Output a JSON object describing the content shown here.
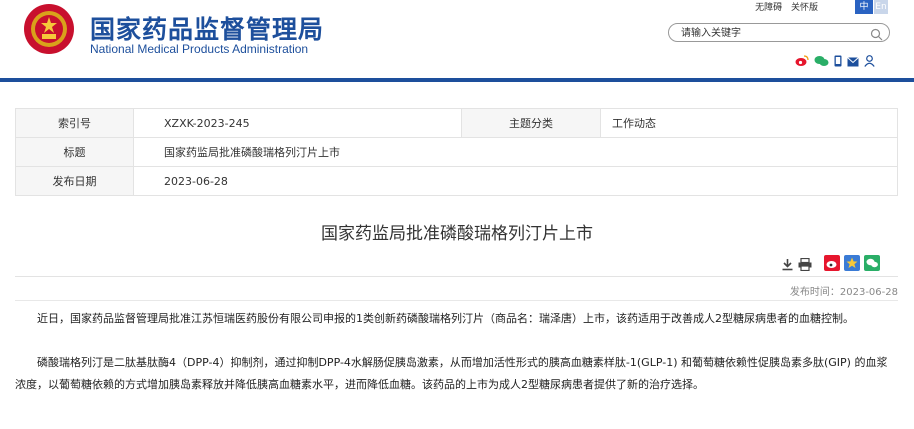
{
  "header": {
    "title_cn": "国家药品监督管理局",
    "title_en": "National Medical Products Administration",
    "accessibility_link": "无障碍",
    "care_link": "关怀版",
    "lang_cn": "中",
    "lang_en": "En",
    "search_placeholder": "请输入关键字"
  },
  "meta": {
    "index_label": "索引号",
    "index_value": "XZXK-2023-245",
    "topic_label": "主题分类",
    "topic_value": "工作动态",
    "title_label": "标题",
    "title_value": "国家药监局批准磷酸瑞格列汀片上市",
    "date_label": "发布日期",
    "date_value": "2023-06-28"
  },
  "article": {
    "title": "国家药监局批准磷酸瑞格列汀片上市",
    "pub_time": "发布时间：2023-06-28",
    "paragraph1": "近日，国家药品监督管理局批准江苏恒瑞医药股份有限公司申报的1类创新药磷酸瑞格列汀片（商品名：瑞泽唐）上市，该药适用于改善成人2型糖尿病患者的血糖控制。",
    "paragraph2": "磷酸瑞格列汀是二肽基肽酶4（DPP-4）抑制剂，通过抑制DPP-4水解肠促胰岛激素，从而增加活性形式的胰高血糖素样肽-1(GLP-1) 和葡萄糖依赖性促胰岛素多肽(GIP) 的血浆浓度，以葡萄糖依赖的方式增加胰岛素释放并降低胰高血糖素水平，进而降低血糖。该药品的上市为成人2型糖尿病患者提供了新的治疗选择。"
  },
  "colors": {
    "brand_blue": "#1d4f9c",
    "emblem_red": "#c8102e"
  },
  "icons": [
    "search-icon",
    "weibo-icon",
    "wechat-icon",
    "mobile-icon",
    "mail-icon",
    "user-icon",
    "download-icon",
    "print-icon",
    "share-weibo-icon",
    "share-qzone-icon",
    "share-wechat-icon"
  ]
}
